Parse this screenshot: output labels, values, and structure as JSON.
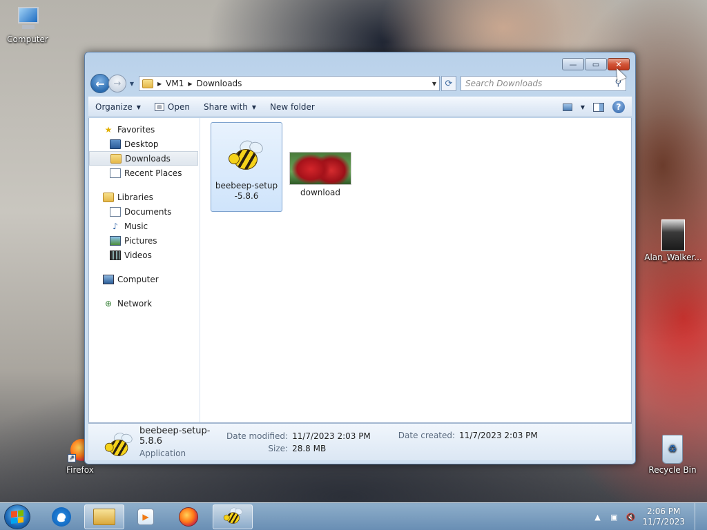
{
  "desktop": {
    "icons": [
      {
        "label": "Computer"
      },
      {
        "label": "Firefox"
      },
      {
        "label": "Alan_Walker..."
      },
      {
        "label": "Recycle Bin"
      }
    ]
  },
  "window": {
    "controls": {
      "minimize": "—",
      "maximize": "▭",
      "close": "✕"
    },
    "address": {
      "crumbs": [
        "VM1",
        "Downloads"
      ]
    },
    "search": {
      "placeholder": "Search Downloads"
    },
    "toolbar": {
      "organize": "Organize",
      "open": "Open",
      "share_with": "Share with",
      "new_folder": "New folder"
    },
    "nav": {
      "favorites": {
        "label": "Favorites",
        "items": [
          "Desktop",
          "Downloads",
          "Recent Places"
        ]
      },
      "libraries": {
        "label": "Libraries",
        "items": [
          "Documents",
          "Music",
          "Pictures",
          "Videos"
        ]
      },
      "computer": {
        "label": "Computer"
      },
      "network": {
        "label": "Network"
      },
      "selected": "Downloads"
    },
    "files": [
      {
        "name": "beebeep-setup-5.8.6",
        "icon": "bee-icon",
        "selected": true
      },
      {
        "name": "download",
        "icon": "strawberry-thumbnail",
        "selected": false
      }
    ],
    "details": {
      "name": "beebeep-setup-5.8.6",
      "type": "Application",
      "date_modified_label": "Date modified:",
      "date_modified": "11/7/2023 2:03 PM",
      "size_label": "Size:",
      "size": "28.8 MB",
      "date_created_label": "Date created:",
      "date_created": "11/7/2023 2:03 PM"
    }
  },
  "taskbar": {
    "clock": {
      "time": "2:06 PM",
      "date": "11/7/2023"
    }
  }
}
